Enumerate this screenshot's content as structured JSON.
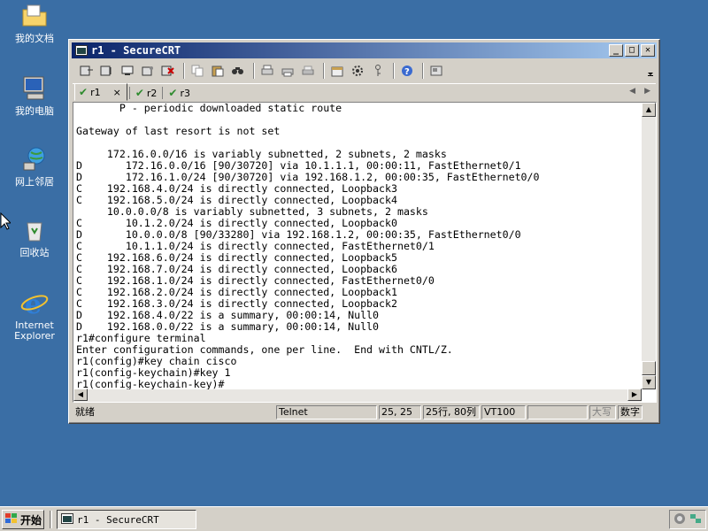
{
  "desktop": {
    "icons": [
      {
        "label": "我的文档"
      },
      {
        "label": "我的电脑"
      },
      {
        "label": "网上邻居"
      },
      {
        "label": "回收站"
      },
      {
        "label": "Internet Explorer"
      }
    ]
  },
  "window": {
    "title": "r1 - SecureCRT",
    "tabs": [
      {
        "label": "r1",
        "active": true,
        "close": "×"
      },
      {
        "label": "r2"
      },
      {
        "label": "r3"
      }
    ]
  },
  "terminal": {
    "lines": [
      "       P - periodic downloaded static route",
      "",
      "Gateway of last resort is not set",
      "",
      "     172.16.0.0/16 is variably subnetted, 2 subnets, 2 masks",
      "D       172.16.0.0/16 [90/30720] via 10.1.1.1, 00:00:11, FastEthernet0/1",
      "D       172.16.1.0/24 [90/30720] via 192.168.1.2, 00:00:35, FastEthernet0/0",
      "C    192.168.4.0/24 is directly connected, Loopback3",
      "C    192.168.5.0/24 is directly connected, Loopback4",
      "     10.0.0.0/8 is variably subnetted, 3 subnets, 2 masks",
      "C       10.1.2.0/24 is directly connected, Loopback0",
      "D       10.0.0.0/8 [90/33280] via 192.168.1.2, 00:00:35, FastEthernet0/0",
      "C       10.1.1.0/24 is directly connected, FastEthernet0/1",
      "C    192.168.6.0/24 is directly connected, Loopback5",
      "C    192.168.7.0/24 is directly connected, Loopback6",
      "C    192.168.1.0/24 is directly connected, FastEthernet0/0",
      "C    192.168.2.0/24 is directly connected, Loopback1",
      "C    192.168.3.0/24 is directly connected, Loopback2",
      "D    192.168.4.0/22 is a summary, 00:00:14, Null0",
      "D    192.168.0.0/22 is a summary, 00:00:14, Null0",
      "r1#configure terminal",
      "Enter configuration commands, one per line.  End with CNTL/Z.",
      "r1(config)#key chain cisco",
      "r1(config-keychain)#key 1",
      "r1(config-keychain-key)#"
    ]
  },
  "status": {
    "ready": "就绪",
    "protocol": "Telnet",
    "cursor": "25, 25",
    "size": "25行, 80列",
    "emulation": "VT100",
    "caps": "大写",
    "num": "数字"
  },
  "taskbar": {
    "start": "开始",
    "task": "r1 - SecureCRT"
  },
  "colors": {
    "desktop": "#3a6ea5",
    "title_start": "#0a246a",
    "title_end": "#a6caf0"
  }
}
